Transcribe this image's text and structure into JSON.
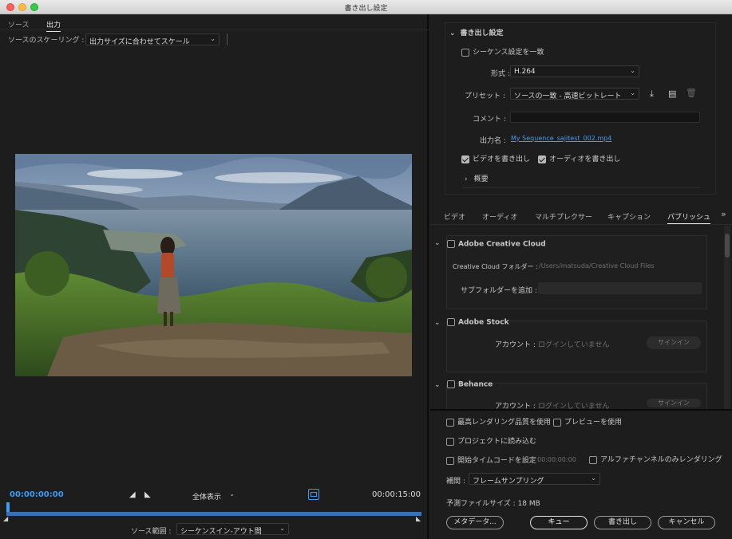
{
  "window": {
    "title": "書き出し設定"
  },
  "left": {
    "tabs": [
      {
        "label": "ソース"
      },
      {
        "label": "出力"
      }
    ],
    "scaling_label": "ソースのスケーリング :",
    "scaling_value": "出力サイズに合わせてスケール",
    "timecode_start": "00:00:00:00",
    "timecode_end": "00:00:15:00",
    "zoom_value": "全体表示",
    "source_range_label": "ソース範囲 :",
    "source_range_value": "シーケンスイン-アウト間",
    "playhead_position": 0
  },
  "export_settings": {
    "header": "書き出し設定",
    "match_sequence": "シーケンス設定を一致",
    "match_sequence_checked": false,
    "format_label": "形式 :",
    "format_value": "H.264",
    "preset_label": "プリセット :",
    "preset_value": "ソースの一致 - 高速ビットレート",
    "comment_label": "コメント :",
    "comment_value": "",
    "output_name_label": "出力名 :",
    "output_name_value": "My Sequence_sajitest_002.mp4",
    "export_video": "ビデオを書き出し",
    "export_video_checked": true,
    "export_audio": "オーディオを書き出し",
    "export_audio_checked": true,
    "summary_label": "概要"
  },
  "subtabs": [
    {
      "label": "ビデオ"
    },
    {
      "label": "オーディオ"
    },
    {
      "label": "マルチプレクサー"
    },
    {
      "label": "キャプション"
    },
    {
      "label": "パブリッシュ"
    }
  ],
  "subtabs_more": "»",
  "publish": {
    "creative_cloud": {
      "title": "Adobe Creative Cloud",
      "folder_label": "Creative Cloud フォルダー :",
      "folder_value": "/Users/matsuda/Creative Cloud Files",
      "subfolder_label": "サブフォルダーを追加 :",
      "subfolder_value": ""
    },
    "stock": {
      "title": "Adobe Stock",
      "account_label": "アカウント :",
      "account_value": "ログインしていません",
      "signin_label": "サインイン"
    },
    "behance": {
      "title": "Behance",
      "account_label": "アカウント :",
      "account_value": "ログインしていません",
      "signin_label": "サインイン"
    }
  },
  "bottom": {
    "max_render": "最高レンダリング品質を使用",
    "use_preview": "プレビューを使用",
    "import_project": "プロジェクトに読み込む",
    "start_timecode": "開始タイムコードを設定",
    "start_timecode_value": "00:00:00:00",
    "alpha_only": "アルファチャンネルのみレンダリング",
    "interp_label": "補間 :",
    "interp_value": "フレームサンプリング",
    "filesize_label": "予測ファイルサイズ :",
    "filesize_value": "18 MB",
    "metadata_button": "メタデータ...",
    "queue_button": "キュー",
    "export_button": "書き出し",
    "cancel_button": "キャンセル"
  },
  "colors": {
    "accent": "#3f9cf4",
    "background": "#1d1d1d"
  }
}
